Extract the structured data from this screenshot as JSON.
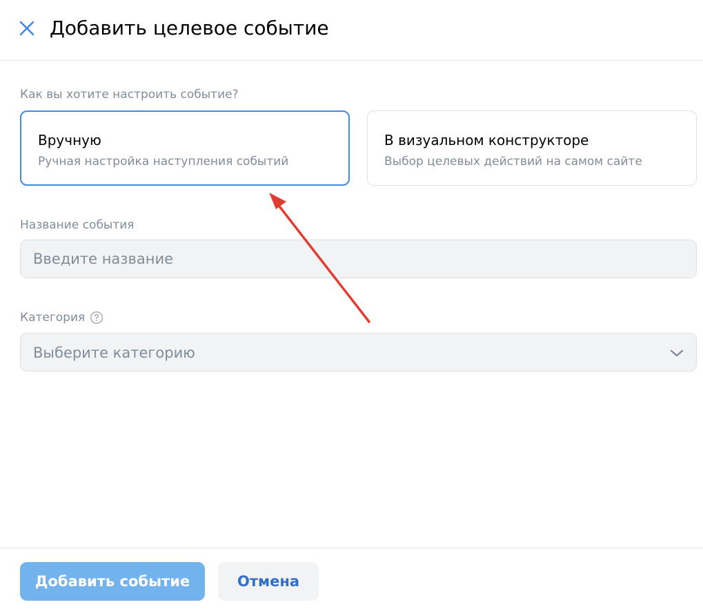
{
  "header": {
    "title": "Добавить целевое событие",
    "close_icon": "close-icon"
  },
  "setup": {
    "question": "Как вы хотите настроить событие?",
    "options": [
      {
        "title": "Вручную",
        "description": "Ручная настройка наступления событий",
        "selected": true
      },
      {
        "title": "В визуальном конструкторе",
        "description": "Выбор целевых действий на самом сайте",
        "selected": false
      }
    ]
  },
  "form": {
    "name": {
      "label": "Название события",
      "placeholder": "Введите название",
      "value": ""
    },
    "category": {
      "label": "Категория",
      "placeholder": "Выберите категорию",
      "help_icon": "question-circle-icon",
      "dropdown_icon": "chevron-down-icon"
    }
  },
  "footer": {
    "submit_label": "Добавить событие",
    "cancel_label": "Отмена"
  },
  "colors": {
    "accent": "#3f8ae0",
    "primary_button": "#72b3ee",
    "secondary_text": "#818c99",
    "annotation_arrow": "#e03c31"
  }
}
